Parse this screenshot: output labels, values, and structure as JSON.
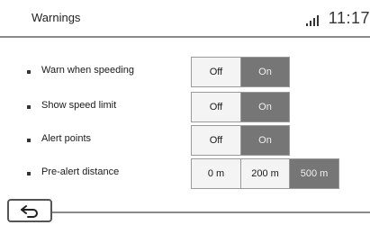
{
  "header": {
    "title": "Warnings",
    "time": "11:17"
  },
  "settings": [
    {
      "label": "Warn when speeding",
      "options": [
        "Off",
        "On"
      ],
      "selected": "On"
    },
    {
      "label": "Show speed limit",
      "options": [
        "Off",
        "On"
      ],
      "selected": "On"
    },
    {
      "label": "Alert points",
      "options": [
        "Off",
        "On"
      ],
      "selected": "On"
    },
    {
      "label": "Pre-alert distance",
      "options": [
        "0 m",
        "200 m",
        "500 m"
      ],
      "selected": "500 m"
    }
  ],
  "footer": {
    "back_icon": "back-arrow-icon"
  }
}
